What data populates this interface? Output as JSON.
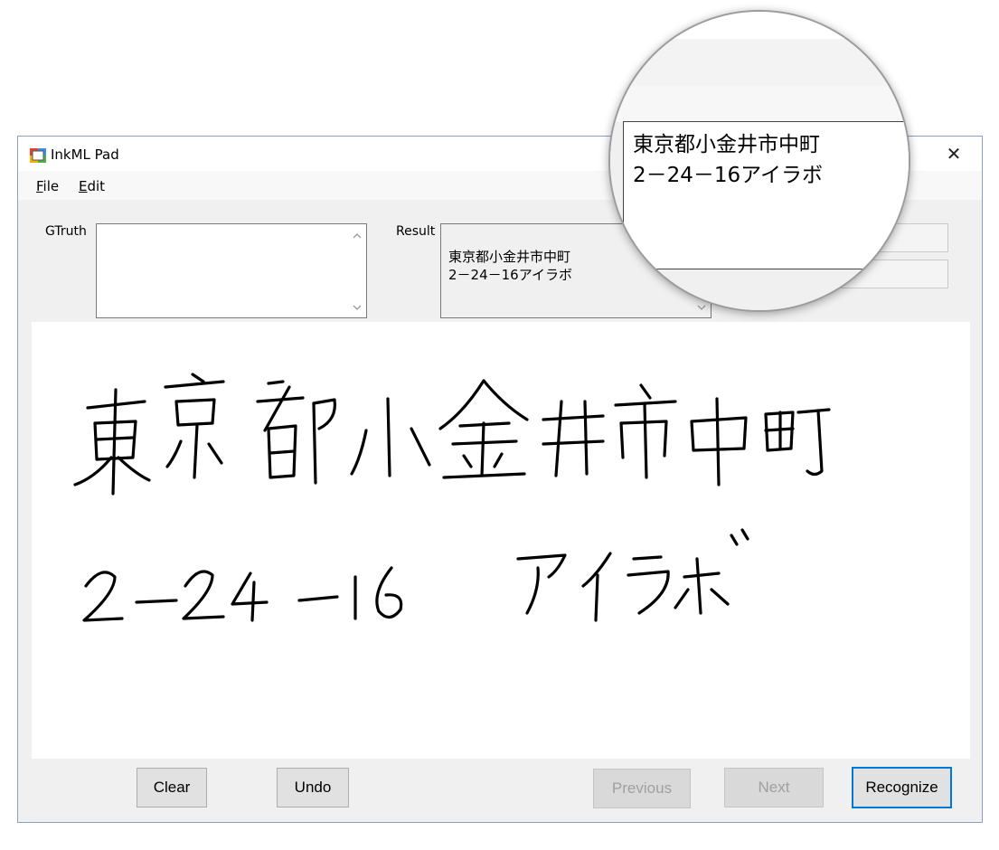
{
  "window": {
    "title": "InkML Pad",
    "maximize_glyph": "□",
    "close_glyph": "✕"
  },
  "menu": {
    "file": {
      "accel": "F",
      "rest": "ile"
    },
    "edit": {
      "accel": "E",
      "rest": "dit"
    }
  },
  "gtruth": {
    "label": "GTruth",
    "value": ""
  },
  "result": {
    "label": "Result",
    "value": "東京都小金井市中町\n2－24－16アイラボ"
  },
  "buttons": {
    "clear": "Clear",
    "undo": "Undo",
    "previous": "Previous",
    "next": "Next",
    "recognize": "Recognize"
  },
  "magnifier": {
    "text": "東京都小金井市中町\n2－24－16アイラボ"
  },
  "colors": {
    "window_border": "#8a9ec6",
    "form_background": "#f0f0f0",
    "default_button_border": "#0078d7",
    "ink": "#000000"
  }
}
